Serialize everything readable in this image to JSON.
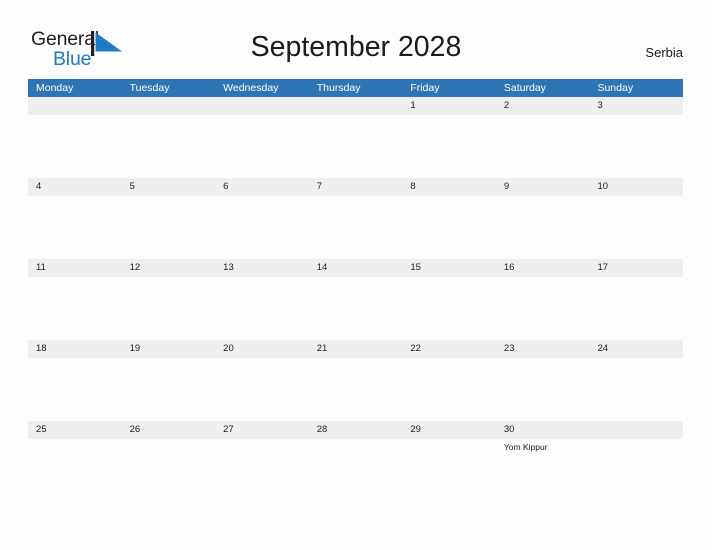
{
  "brand": {
    "name_part1": "General",
    "name_part2": "Blue",
    "flag_icon": "flag-icon",
    "color_dark": "#231f20",
    "color_blue": "#1d7cc4"
  },
  "header": {
    "title": "September 2028",
    "country": "Serbia"
  },
  "theme": {
    "header_blue": "#2e75b6",
    "band_gray": "#efefef",
    "page_background": "#fdfdfd",
    "text_dark": "#1c1c1c",
    "text_on_blue": "#ffffff"
  },
  "calendar": {
    "weekday_headers": [
      "Monday",
      "Tuesday",
      "Wednesday",
      "Thursday",
      "Friday",
      "Saturday",
      "Sunday"
    ],
    "weeks": [
      [
        {
          "date": "",
          "events": []
        },
        {
          "date": "",
          "events": []
        },
        {
          "date": "",
          "events": []
        },
        {
          "date": "",
          "events": []
        },
        {
          "date": "1",
          "events": []
        },
        {
          "date": "2",
          "events": []
        },
        {
          "date": "3",
          "events": []
        }
      ],
      [
        {
          "date": "4",
          "events": []
        },
        {
          "date": "5",
          "events": []
        },
        {
          "date": "6",
          "events": []
        },
        {
          "date": "7",
          "events": []
        },
        {
          "date": "8",
          "events": []
        },
        {
          "date": "9",
          "events": []
        },
        {
          "date": "10",
          "events": []
        }
      ],
      [
        {
          "date": "11",
          "events": []
        },
        {
          "date": "12",
          "events": []
        },
        {
          "date": "13",
          "events": []
        },
        {
          "date": "14",
          "events": []
        },
        {
          "date": "15",
          "events": []
        },
        {
          "date": "16",
          "events": []
        },
        {
          "date": "17",
          "events": []
        }
      ],
      [
        {
          "date": "18",
          "events": []
        },
        {
          "date": "19",
          "events": []
        },
        {
          "date": "20",
          "events": []
        },
        {
          "date": "21",
          "events": []
        },
        {
          "date": "22",
          "events": []
        },
        {
          "date": "23",
          "events": []
        },
        {
          "date": "24",
          "events": []
        }
      ],
      [
        {
          "date": "25",
          "events": []
        },
        {
          "date": "26",
          "events": []
        },
        {
          "date": "27",
          "events": []
        },
        {
          "date": "28",
          "events": []
        },
        {
          "date": "29",
          "events": []
        },
        {
          "date": "30",
          "events": [
            "Yom Kippur"
          ]
        },
        {
          "date": "",
          "events": []
        }
      ]
    ]
  }
}
